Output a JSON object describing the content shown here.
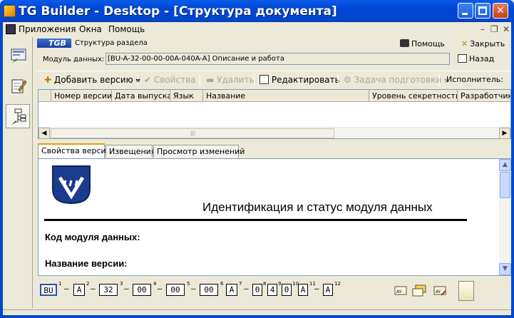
{
  "window": {
    "title": "TG Builder - Desktop - [Структура документа]"
  },
  "menubar": {
    "items": [
      "Приложения",
      "Окна",
      "Помощь"
    ]
  },
  "section": {
    "title": "Структура раздела",
    "help_label": "Помощь",
    "close_label": "Закрыть",
    "back_label": "Назад",
    "module_label": "Модуль данных:",
    "module_value": "[BU-A-32-00-00-00A-040A-A]  Описание и работа"
  },
  "toolbar": {
    "add_version": "Добавить версию",
    "properties": "Свойства",
    "delete": "Удалить",
    "edit": "Редактировать",
    "prep_task": "Задача подготовки",
    "executor": "Исполнитель:"
  },
  "grid": {
    "columns": [
      "Номер версии",
      "Дата выпуска",
      "Язык",
      "Название",
      "Уровень секретности",
      "Разработчик"
    ],
    "rows": []
  },
  "tabs": [
    "Свойства версии",
    "Извещения",
    "Просмотр изменений"
  ],
  "document": {
    "heading": "Идентификация и статус модуля данных",
    "label_code": "Код модуля данных:",
    "label_name": "Название версии:"
  },
  "codebar": {
    "segments": [
      "BU",
      "A",
      "32",
      "00",
      "00",
      "00",
      "A",
      "0",
      "4",
      "0",
      "A",
      "A"
    ],
    "numbers": [
      "1",
      "2",
      "3",
      "4",
      "5",
      "6",
      "7",
      "8",
      "9",
      "10",
      "11",
      "12"
    ]
  },
  "colors": {
    "titlebar": "#0047d0",
    "accent_tab": "#e69e00",
    "window_bg": "#ece9d8"
  }
}
